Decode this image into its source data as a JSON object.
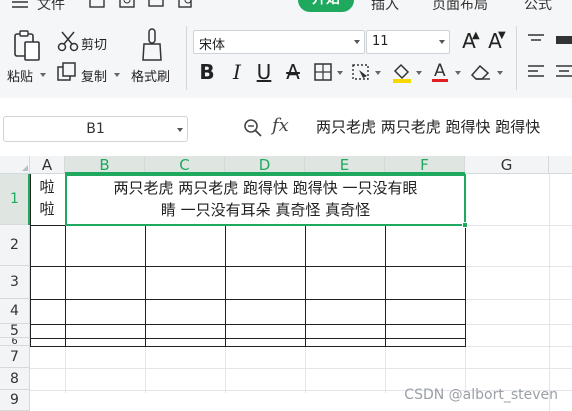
{
  "menubar": {
    "file_label": "文件",
    "tabs": [
      "开始",
      "插入",
      "页面布局",
      "公式"
    ]
  },
  "ribbon": {
    "paste_label": "粘贴",
    "cut_label": "剪切",
    "copy_label": "复制",
    "format_painter_label": "格式刷",
    "font_name": "宋体",
    "font_size": "11"
  },
  "formula_bar": {
    "name_box": "B1",
    "fx_label": "fx",
    "content": "两只老虎 两只老虎 跑得快 跑得快"
  },
  "grid": {
    "columns": [
      "A",
      "B",
      "C",
      "D",
      "E",
      "F",
      "G"
    ],
    "rows": [
      "1",
      "2",
      "3",
      "4",
      "5",
      "6",
      "7",
      "8",
      "9"
    ],
    "a1_text": "啦啦",
    "merged_b1_line1": "两只老虎 两只老虎 跑得快 跑得快 一只没有眼",
    "merged_b1_line2": "睛 一只没有耳朵 真奇怪 真奇怪",
    "accent_color": "#1fa95e"
  },
  "watermark": "CSDN @albort_steven"
}
